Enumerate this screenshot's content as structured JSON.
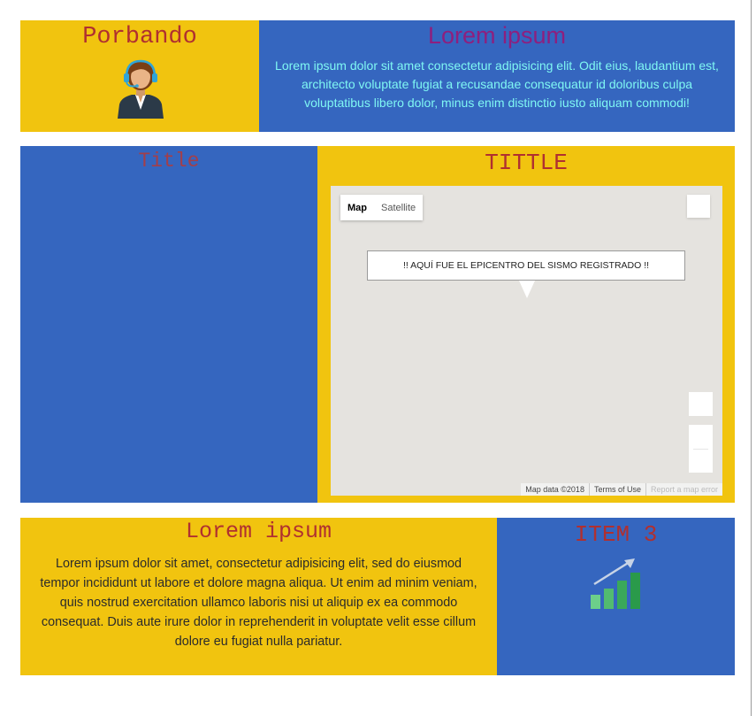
{
  "header": {
    "brand": "Porbando",
    "title": "Lorem ipsum",
    "text": "Lorem ipsum dolor sit amet consectetur adipisicing elit. Odit eius, laudantium est, architecto voluptate fugiat a recusandae consequatur id doloribus culpa voluptatibus libero dolor, minus enim distinctio iusto aliquam commodi!"
  },
  "middle": {
    "left_title": "Title",
    "right_title": "TITTLE",
    "map": {
      "map_label": "Map",
      "satellite_label": "Satellite",
      "info_text": "!! AQUÍ FUE EL EPICENTRO DEL SISMO REGISTRADO !!",
      "attribution": "Map data ©2018",
      "terms": "Terms of Use",
      "report": "Report a map error"
    }
  },
  "footer": {
    "title": "Lorem ipsum",
    "text": "Lorem ipsum dolor sit amet, consectetur adipisicing elit, sed do eiusmod tempor incididunt ut labore et dolore magna aliqua. Ut enim ad minim veniam, quis nostrud exercitation ullamco laboris nisi ut aliquip ex ea commodo consequat. Duis aute irure dolor in reprehenderit in voluptate velit esse cillum dolore eu fugiat nulla pariatur.",
    "item_title": "ITEM 3",
    "item_icon": "growth-chart-icon"
  },
  "colors": {
    "yellow": "#f1c40f",
    "blue": "#3566bf",
    "title_red": "#b03030",
    "header_title": "#8e1f7e",
    "header_text": "#7ff7f3"
  }
}
